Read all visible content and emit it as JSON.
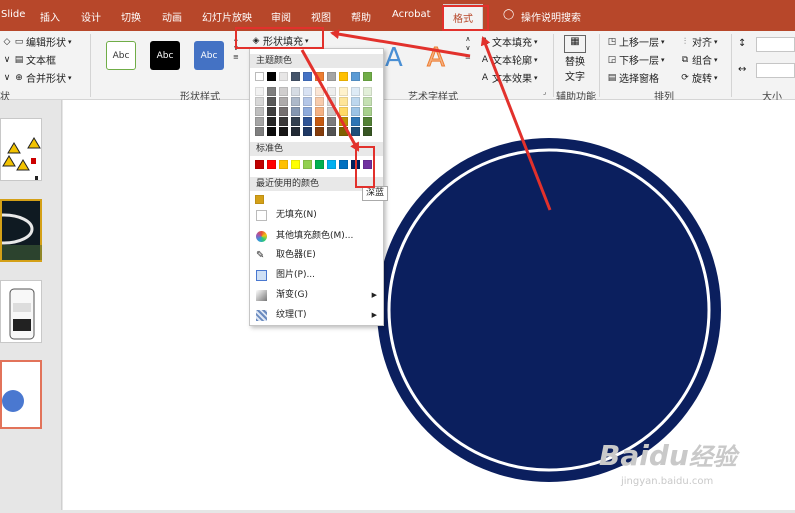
{
  "tabs": [
    "Slide",
    "插入",
    "设计",
    "切换",
    "动画",
    "幻灯片放映",
    "审阅",
    "视图",
    "帮助",
    "Acrobat",
    "格式",
    "操作说明搜索"
  ],
  "insert_shapes": {
    "edit_shape": "编辑形状",
    "text_box": "文本框",
    "merge_shapes": "合并形状",
    "group_label": "状"
  },
  "shape_styles": {
    "items": [
      "Abc",
      "Abc",
      "Abc"
    ],
    "fill": "形状填充",
    "group_label": "形状样式"
  },
  "wordart": {
    "fill": "文本填充",
    "outline": "文本轮廓",
    "effects": "文本效果",
    "group_label": "艺术字样式"
  },
  "accessibility": {
    "alt_text_line1": "替换",
    "alt_text_line2": "文字",
    "group_label": "辅助功能"
  },
  "arrange": {
    "bring_forward": "上移一层",
    "send_backward": "下移一层",
    "selection_pane": "选择窗格",
    "align": "对齐",
    "group": "组合",
    "rotate": "旋转",
    "group_label": "排列"
  },
  "size": {
    "group_label": "大小"
  },
  "fill_menu": {
    "theme_colors_label": "主题颜色",
    "standard_colors_label": "标准色",
    "recent_colors_label": "最近使用的颜色",
    "theme_top_row": [
      "#ffffff",
      "#000000",
      "#e7e6e6",
      "#44546a",
      "#4472c4",
      "#ed7d31",
      "#a5a5a5",
      "#ffc000",
      "#5b9bd5",
      "#70ad47"
    ],
    "theme_shades": [
      [
        "#f2f2f2",
        "#7f7f7f",
        "#d0cece",
        "#d6dce4",
        "#d9e2f3",
        "#fbe5d5",
        "#ededed",
        "#fff2cc",
        "#deebf6",
        "#e2efd9"
      ],
      [
        "#d8d8d8",
        "#595959",
        "#aeabab",
        "#adb9ca",
        "#b4c6e7",
        "#f7cbac",
        "#dbdbdb",
        "#fee599",
        "#bdd7ee",
        "#c5e0b3"
      ],
      [
        "#bfbfbf",
        "#3f3f3f",
        "#757070",
        "#8496b0",
        "#8eaadb",
        "#f4b183",
        "#c9c9c9",
        "#ffd965",
        "#9cc3e5",
        "#a8d08d"
      ],
      [
        "#a5a5a5",
        "#262626",
        "#3a3838",
        "#323f4f",
        "#2f5496",
        "#c55a11",
        "#7b7b7b",
        "#bf9000",
        "#2e75b5",
        "#538135"
      ],
      [
        "#7f7f7f",
        "#0c0c0c",
        "#171616",
        "#222a35",
        "#1f3864",
        "#843c0b",
        "#525252",
        "#7f6000",
        "#1e4e79",
        "#375623"
      ]
    ],
    "standard_colors": [
      "#c00000",
      "#ff0000",
      "#ffc000",
      "#ffff00",
      "#92d050",
      "#00b050",
      "#00b0f0",
      "#0070c0",
      "#002060",
      "#7030a0"
    ],
    "recent_colors": [
      "#d4a017"
    ],
    "no_fill": "无填充(N)",
    "more_colors": "其他填充颜色(M)...",
    "eyedropper": "取色器(E)",
    "picture": "图片(P)...",
    "gradient": "渐变(G)",
    "texture": "纹理(T)"
  },
  "tooltip": "深蓝",
  "circle": {
    "fill": "#0b1f5e",
    "ring": "#ffffff"
  },
  "watermark": {
    "brand": "Baidu",
    "cn": "经验",
    "url": "jingyan.baidu.com"
  },
  "colors": {
    "accent": "#b7472a",
    "annotation": "#e2312c"
  }
}
